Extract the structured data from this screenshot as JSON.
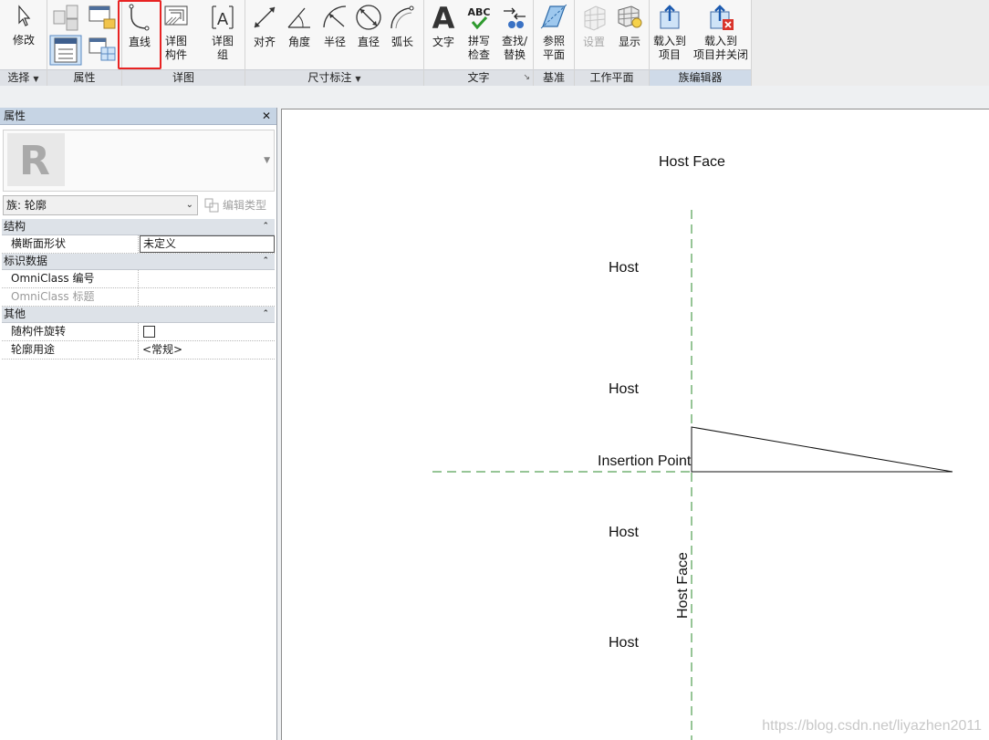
{
  "ribbon": {
    "select_panel": {
      "modify_label": "修改",
      "title": "选择"
    },
    "properties_panel": {
      "title": "属性"
    },
    "detail_panel": {
      "line_label": "直线",
      "detail_component_label": "详图\n构件",
      "detail_group_label": "详图\n组",
      "title": "详图"
    },
    "dimension_panel": {
      "aligned_label": "对齐",
      "angular_label": "角度",
      "radial_label": "半径",
      "diameter_label": "直径",
      "arc_length_label": "弧长",
      "title": "尺寸标注"
    },
    "text_panel": {
      "text_label": "文字",
      "spelling_label": "拼写\n检查",
      "find_replace_label": "查找/\n替换",
      "title": "文字",
      "spelling_icon_text": "ABC"
    },
    "datum_panel": {
      "ref_plane_label": "参照\n平面",
      "title": "基准"
    },
    "work_plane_panel": {
      "set_label": "设置",
      "show_label": "显示",
      "title": "工作平面"
    },
    "family_editor_panel": {
      "load_into_project_label": "载入到\n项目",
      "load_close_label": "载入到\n项目并关闭",
      "title": "族编辑器"
    },
    "highlight_color": "#e82323"
  },
  "properties": {
    "header": "属性",
    "close": "✕",
    "family_selector": "族: 轮廓",
    "edit_type": "编辑类型",
    "groups": [
      {
        "name": "结构",
        "rows": [
          {
            "key": "横断面形状",
            "value": "未定义"
          }
        ]
      },
      {
        "name": "标识数据",
        "rows": [
          {
            "key": "OmniClass 编号",
            "value": ""
          },
          {
            "key": "OmniClass 标题",
            "value": ""
          }
        ]
      },
      {
        "name": "其他",
        "rows": [
          {
            "key": "随构件旋转",
            "value": ""
          },
          {
            "key": "轮廓用途",
            "value": "<常规>"
          }
        ]
      }
    ]
  },
  "canvas": {
    "labels": {
      "host_face_top": "Host Face",
      "host_1": "Host",
      "host_2": "Host",
      "insertion_point": "Insertion Point",
      "host_3": "Host",
      "host_face_vertical": "Host Face",
      "host_4": "Host"
    },
    "reference_line_color": "#2e8b2e",
    "watermark": "https://blog.csdn.net/liyazhen2011"
  }
}
